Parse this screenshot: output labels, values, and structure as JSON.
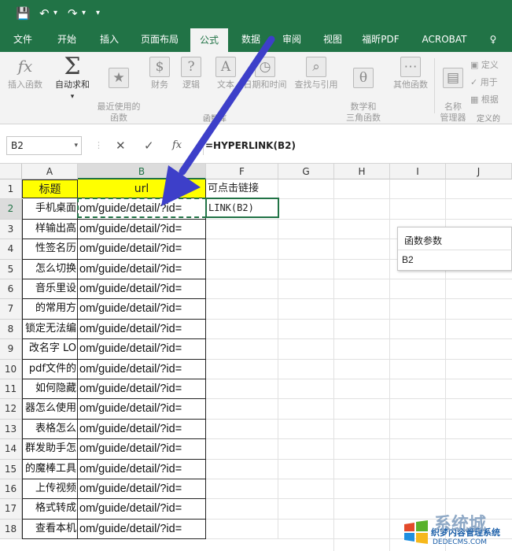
{
  "quick_access": {
    "save_icon": "save-icon",
    "undo_icon": "undo-icon",
    "redo_icon": "redo-icon",
    "customize_icon": "customize-icon"
  },
  "tabs": [
    "文件",
    "开始",
    "插入",
    "页面布局",
    "公式",
    "数据",
    "审阅",
    "视图",
    "福昕PDF",
    "ACROBAT",
    "♀"
  ],
  "active_tab": "公式",
  "ribbon": {
    "buttons": [
      {
        "label": "插入函数",
        "icon": "fx"
      },
      {
        "label": "自动求和",
        "icon": "Σ"
      },
      {
        "label": "最近使用的\n函数",
        "icon": "★"
      },
      {
        "label": "财务",
        "icon": "$"
      },
      {
        "label": "逻辑",
        "icon": "?"
      },
      {
        "label": "文本",
        "icon": "A"
      },
      {
        "label": "日期和时间",
        "icon": "◷"
      },
      {
        "label": "查找与引用",
        "icon": "⌕"
      },
      {
        "label": "数学和\n三角函数",
        "icon": "θ"
      },
      {
        "label": "其他函数",
        "icon": "⋯"
      },
      {
        "label": "名称\n管理器",
        "icon": "▤"
      }
    ],
    "group_label": "函数库",
    "side_items": [
      "定义",
      "用于",
      "根据",
      "定义的"
    ]
  },
  "name_box": "B2",
  "formula_bar": {
    "cancel": "✕",
    "enter": "✓",
    "fx": "fx",
    "content": "=HYPERLINK(B2)"
  },
  "columns": [
    "A",
    "B",
    "F",
    "G",
    "H",
    "I",
    "J"
  ],
  "rows": [
    "1",
    "2",
    "3",
    "4",
    "5",
    "6",
    "7",
    "8",
    "9",
    "10",
    "11",
    "12",
    "13",
    "14",
    "15",
    "16",
    "17",
    "18"
  ],
  "header_row": {
    "a": "标题",
    "b": "url",
    "f": "可点击链接"
  },
  "active_cell_text": "LINK(B2)",
  "col_a": [
    "手机桌面",
    "样输出高",
    "性签名历",
    "怎么切换",
    "音乐里设",
    "的常用方",
    "锁定无法编",
    "改名字 LO",
    "pdf文件的",
    "如何隐藏",
    "器怎么使用",
    "表格怎么",
    "群发助手怎",
    "的魔棒工具",
    "上传视频",
    "格式转成",
    "查看本机"
  ],
  "col_b": "om/guide/detail/?id=",
  "tooltip": {
    "title": "函数参数",
    "value": "B2"
  },
  "watermark": {
    "line1": "织梦内容管理系统",
    "line2": "DEDECMS.COM",
    "logo": "系统城"
  }
}
